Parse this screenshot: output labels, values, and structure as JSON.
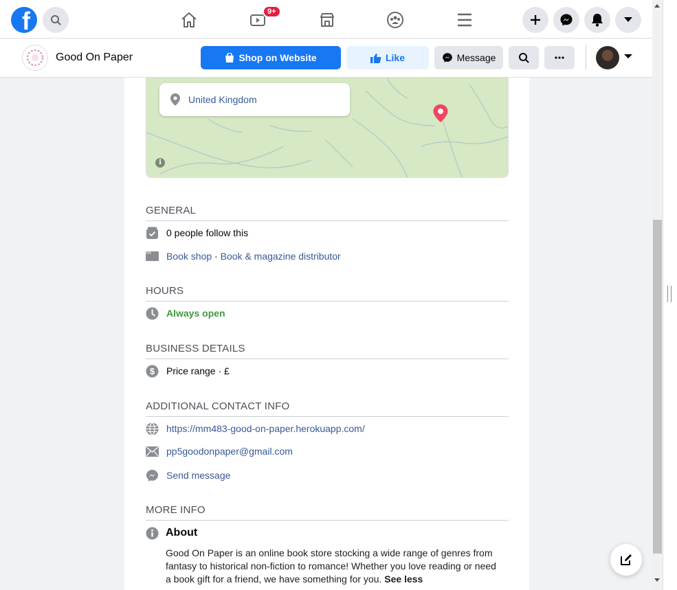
{
  "topnav": {
    "logo": "f",
    "notification_badge": "9+",
    "icons": [
      "facebook-logo",
      "search-icon",
      "home-icon",
      "watch-icon",
      "marketplace-icon",
      "groups-icon",
      "menu-icon",
      "plus-icon",
      "messenger-icon",
      "notifications-icon",
      "account-caret-icon"
    ]
  },
  "pagebar": {
    "page_name": "Good On Paper",
    "shop_label": "Shop on Website",
    "like_label": "Like",
    "message_label": "Message"
  },
  "map": {
    "location": "United Kingdom"
  },
  "general": {
    "title": "GENERAL",
    "followers": "0 people follow this",
    "category1": "Book shop",
    "separator": " · ",
    "category2": "Book & magazine distributor"
  },
  "hours": {
    "title": "HOURS",
    "status": "Always open"
  },
  "business": {
    "title": "BUSINESS DETAILS",
    "price_range": "Price range · £"
  },
  "contact": {
    "title": "ADDITIONAL CONTACT INFO",
    "website": "https://mm483-good-on-paper.herokuapp.com/",
    "email": "pp5goodonpaper@gmail.com",
    "send_message": "Send message"
  },
  "more_info": {
    "title": "MORE INFO",
    "about_title": "About",
    "about_text": "Good On Paper is an online book store stocking a wide range of genres from fantasy to historical non-fiction to romance! Whether you love reading or need a book gift for a friend, we have something for you. ",
    "see_less": "See less"
  },
  "colors": {
    "brand_blue": "#1877f2",
    "link": "#385898",
    "open_green": "#3d9a3d",
    "badge_red": "#e41e3f"
  }
}
